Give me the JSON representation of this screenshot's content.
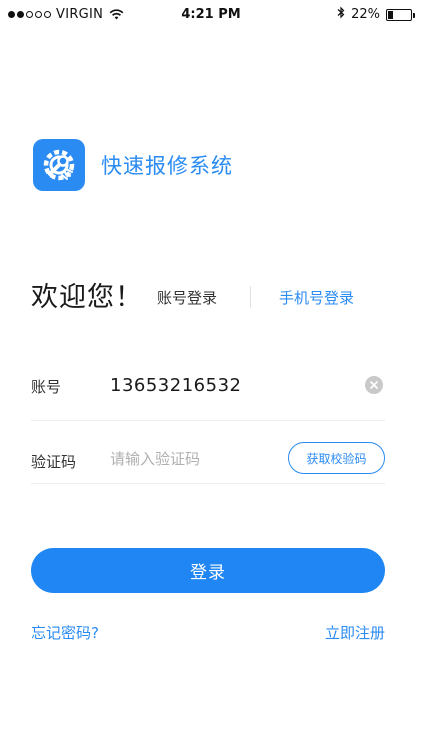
{
  "status_bar": {
    "carrier": "VIRGIN",
    "time": "4:21 PM",
    "battery": "22%",
    "battery_level": 0.22,
    "signal_bars_filled": 2,
    "signal_bars_total": 5
  },
  "app": {
    "name": "快速报修系统",
    "accent_color": "#2a8bf2",
    "logo_icon": "wrench-gear-icon"
  },
  "welcome": "欢迎您！",
  "tabs": {
    "account": "账号登录",
    "phone": "手机号登录"
  },
  "form": {
    "account_label": "账号",
    "account_value": "13653216532",
    "code_label": "验证码",
    "code_placeholder": "请输入验证码",
    "get_code_label": "获取校验码"
  },
  "login_label": "登录",
  "forgot_label": "忘记密码?",
  "register_label": "立即注册"
}
